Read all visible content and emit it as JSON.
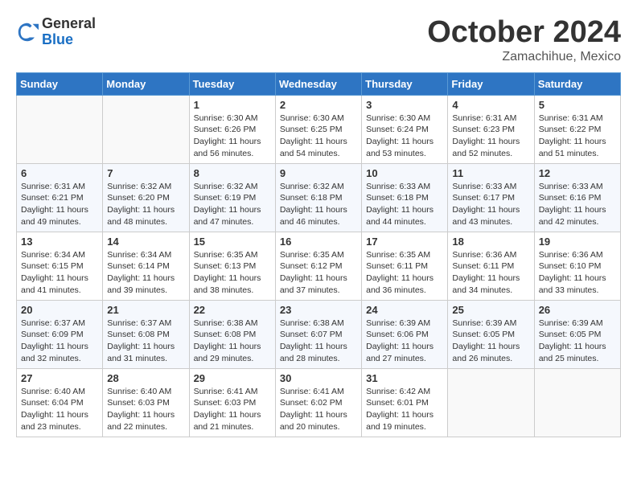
{
  "header": {
    "logo_general": "General",
    "logo_blue": "Blue",
    "month": "October 2024",
    "location": "Zamachihue, Mexico"
  },
  "weekdays": [
    "Sunday",
    "Monday",
    "Tuesday",
    "Wednesday",
    "Thursday",
    "Friday",
    "Saturday"
  ],
  "weeks": [
    [
      {
        "day": "",
        "content": ""
      },
      {
        "day": "",
        "content": ""
      },
      {
        "day": "1",
        "content": "Sunrise: 6:30 AM\nSunset: 6:26 PM\nDaylight: 11 hours and 56 minutes."
      },
      {
        "day": "2",
        "content": "Sunrise: 6:30 AM\nSunset: 6:25 PM\nDaylight: 11 hours and 54 minutes."
      },
      {
        "day": "3",
        "content": "Sunrise: 6:30 AM\nSunset: 6:24 PM\nDaylight: 11 hours and 53 minutes."
      },
      {
        "day": "4",
        "content": "Sunrise: 6:31 AM\nSunset: 6:23 PM\nDaylight: 11 hours and 52 minutes."
      },
      {
        "day": "5",
        "content": "Sunrise: 6:31 AM\nSunset: 6:22 PM\nDaylight: 11 hours and 51 minutes."
      }
    ],
    [
      {
        "day": "6",
        "content": "Sunrise: 6:31 AM\nSunset: 6:21 PM\nDaylight: 11 hours and 49 minutes."
      },
      {
        "day": "7",
        "content": "Sunrise: 6:32 AM\nSunset: 6:20 PM\nDaylight: 11 hours and 48 minutes."
      },
      {
        "day": "8",
        "content": "Sunrise: 6:32 AM\nSunset: 6:19 PM\nDaylight: 11 hours and 47 minutes."
      },
      {
        "day": "9",
        "content": "Sunrise: 6:32 AM\nSunset: 6:18 PM\nDaylight: 11 hours and 46 minutes."
      },
      {
        "day": "10",
        "content": "Sunrise: 6:33 AM\nSunset: 6:18 PM\nDaylight: 11 hours and 44 minutes."
      },
      {
        "day": "11",
        "content": "Sunrise: 6:33 AM\nSunset: 6:17 PM\nDaylight: 11 hours and 43 minutes."
      },
      {
        "day": "12",
        "content": "Sunrise: 6:33 AM\nSunset: 6:16 PM\nDaylight: 11 hours and 42 minutes."
      }
    ],
    [
      {
        "day": "13",
        "content": "Sunrise: 6:34 AM\nSunset: 6:15 PM\nDaylight: 11 hours and 41 minutes."
      },
      {
        "day": "14",
        "content": "Sunrise: 6:34 AM\nSunset: 6:14 PM\nDaylight: 11 hours and 39 minutes."
      },
      {
        "day": "15",
        "content": "Sunrise: 6:35 AM\nSunset: 6:13 PM\nDaylight: 11 hours and 38 minutes."
      },
      {
        "day": "16",
        "content": "Sunrise: 6:35 AM\nSunset: 6:12 PM\nDaylight: 11 hours and 37 minutes."
      },
      {
        "day": "17",
        "content": "Sunrise: 6:35 AM\nSunset: 6:11 PM\nDaylight: 11 hours and 36 minutes."
      },
      {
        "day": "18",
        "content": "Sunrise: 6:36 AM\nSunset: 6:11 PM\nDaylight: 11 hours and 34 minutes."
      },
      {
        "day": "19",
        "content": "Sunrise: 6:36 AM\nSunset: 6:10 PM\nDaylight: 11 hours and 33 minutes."
      }
    ],
    [
      {
        "day": "20",
        "content": "Sunrise: 6:37 AM\nSunset: 6:09 PM\nDaylight: 11 hours and 32 minutes."
      },
      {
        "day": "21",
        "content": "Sunrise: 6:37 AM\nSunset: 6:08 PM\nDaylight: 11 hours and 31 minutes."
      },
      {
        "day": "22",
        "content": "Sunrise: 6:38 AM\nSunset: 6:08 PM\nDaylight: 11 hours and 29 minutes."
      },
      {
        "day": "23",
        "content": "Sunrise: 6:38 AM\nSunset: 6:07 PM\nDaylight: 11 hours and 28 minutes."
      },
      {
        "day": "24",
        "content": "Sunrise: 6:39 AM\nSunset: 6:06 PM\nDaylight: 11 hours and 27 minutes."
      },
      {
        "day": "25",
        "content": "Sunrise: 6:39 AM\nSunset: 6:05 PM\nDaylight: 11 hours and 26 minutes."
      },
      {
        "day": "26",
        "content": "Sunrise: 6:39 AM\nSunset: 6:05 PM\nDaylight: 11 hours and 25 minutes."
      }
    ],
    [
      {
        "day": "27",
        "content": "Sunrise: 6:40 AM\nSunset: 6:04 PM\nDaylight: 11 hours and 23 minutes."
      },
      {
        "day": "28",
        "content": "Sunrise: 6:40 AM\nSunset: 6:03 PM\nDaylight: 11 hours and 22 minutes."
      },
      {
        "day": "29",
        "content": "Sunrise: 6:41 AM\nSunset: 6:03 PM\nDaylight: 11 hours and 21 minutes."
      },
      {
        "day": "30",
        "content": "Sunrise: 6:41 AM\nSunset: 6:02 PM\nDaylight: 11 hours and 20 minutes."
      },
      {
        "day": "31",
        "content": "Sunrise: 6:42 AM\nSunset: 6:01 PM\nDaylight: 11 hours and 19 minutes."
      },
      {
        "day": "",
        "content": ""
      },
      {
        "day": "",
        "content": ""
      }
    ]
  ]
}
